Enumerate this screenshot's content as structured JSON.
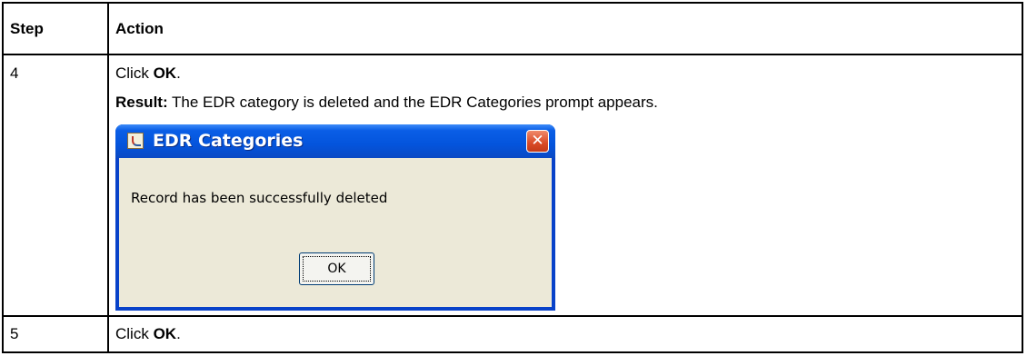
{
  "table": {
    "headers": {
      "step": "Step",
      "action": "Action"
    },
    "rows": [
      {
        "step": "4",
        "action": {
          "prefix": "Click ",
          "bold": "OK",
          "suffix": "."
        },
        "result": {
          "label": "Result:",
          "text": " The EDR category is deleted and the EDR Categories prompt appears."
        }
      },
      {
        "step": "5",
        "action": {
          "prefix": "Click ",
          "bold": "OK",
          "suffix": "."
        }
      }
    ]
  },
  "dialog": {
    "title": "EDR Categories",
    "message": "Record has been successfully deleted",
    "ok_label": "OK",
    "close_symbol": "✕",
    "icon": "java-cup-icon",
    "colors": {
      "titlebar": "#0454dc",
      "client": "#ece9d8",
      "close": "#d94a26"
    }
  }
}
